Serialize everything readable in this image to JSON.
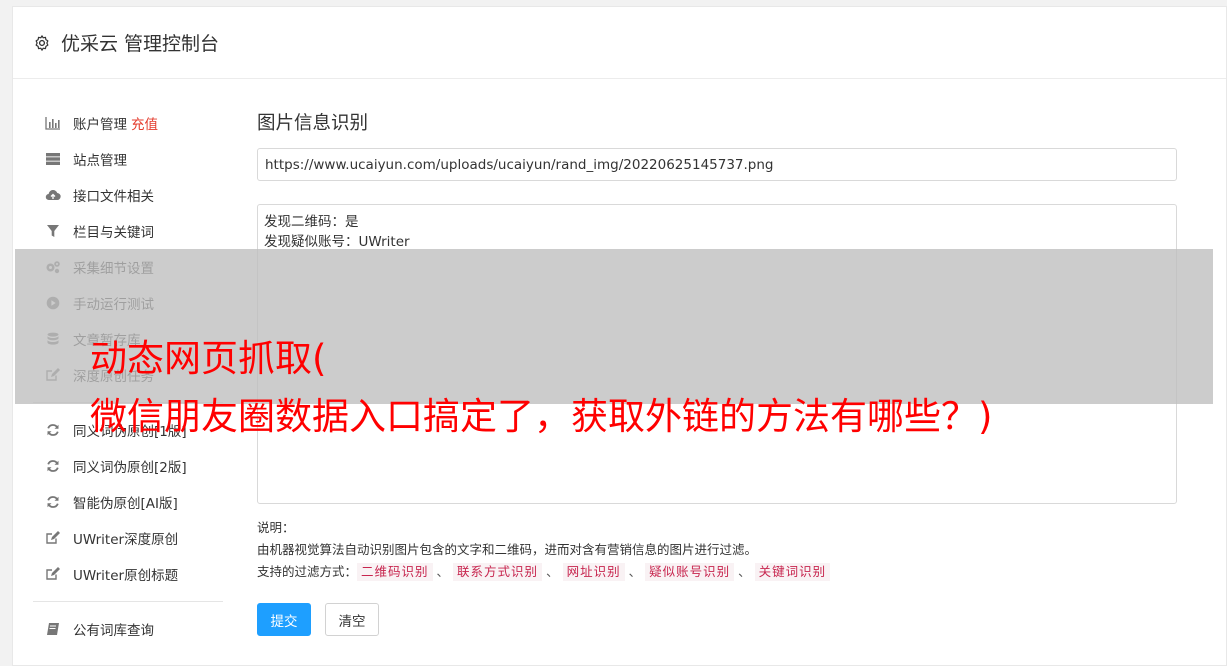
{
  "header": {
    "icon": "gear-icon",
    "title": "优采云 管理控制台"
  },
  "sidebar": {
    "group1": [
      {
        "label": "账户管理",
        "extra": "充值",
        "icon": "bar-chart-icon"
      },
      {
        "label": "站点管理",
        "icon": "server-icon"
      },
      {
        "label": "接口文件相关",
        "icon": "cloud-upload-icon"
      },
      {
        "label": "栏目与关键词",
        "icon": "filter-icon"
      },
      {
        "label": "采集细节设置",
        "icon": "gears-icon"
      },
      {
        "label": "手动运行测试",
        "icon": "play-circle-icon"
      },
      {
        "label": "文章暂存库",
        "icon": "database-icon"
      },
      {
        "label": "深度原创任务",
        "icon": "edit-icon"
      }
    ],
    "group2": [
      {
        "label": "同义词伪原创[1版]",
        "icon": "refresh-icon"
      },
      {
        "label": "同义词伪原创[2版]",
        "icon": "refresh-icon"
      },
      {
        "label": "智能伪原创[AI版]",
        "icon": "refresh-icon"
      },
      {
        "label": "UWriter深度原创",
        "icon": "edit-icon"
      },
      {
        "label": "UWriter原创标题",
        "icon": "edit-icon"
      }
    ],
    "group3": [
      {
        "label": "公有词库查询",
        "icon": "book-icon"
      }
    ]
  },
  "main": {
    "title": "图片信息识别",
    "url_value": "https://www.ucaiyun.com/uploads/ucaiyun/rand_img/20220625145737.png",
    "result_lines": [
      "发现二维码：是",
      "发现疑似账号：UWriter"
    ],
    "notes_label": "说明：",
    "notes_desc": "由机器视觉算法自动识别图片包含的文字和二维码，进而对含有营销信息的图片进行过滤。",
    "filters_label": "支持的过滤方式：",
    "filters": [
      "二维码识别",
      "联系方式识别",
      "网址识别",
      "疑似账号识别",
      "关键词识别"
    ],
    "filter_separator": "、",
    "submit_label": "提交",
    "clear_label": "清空"
  },
  "overlay": {
    "line1": "动态网页抓取(",
    "line2": "微信朋友圈数据入口搞定了，获取外链的方法有哪些？)"
  },
  "colors": {
    "accent": "#1e9fff",
    "recharge": "#e43b2c",
    "tag_text": "#c7254e",
    "overlay_text": "#ff0000"
  }
}
